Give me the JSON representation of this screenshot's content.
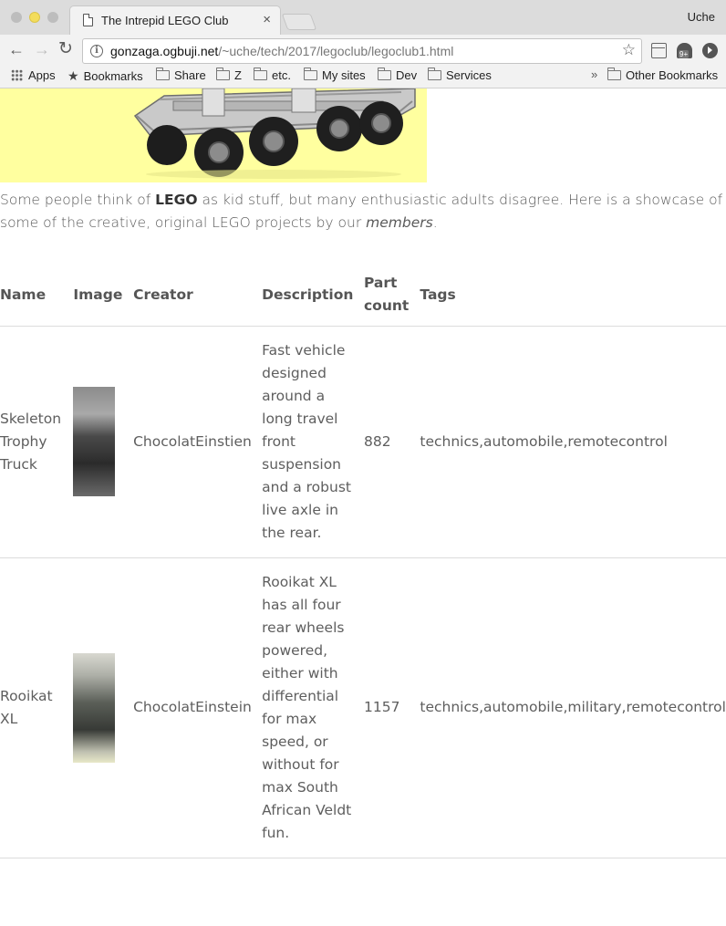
{
  "browser": {
    "tab_title": "The Intrepid LEGO Club",
    "tab_close": "×",
    "profile_name": "Uche",
    "url_host": "gonzaga.ogbuji.net",
    "url_path": "/~uche/tech/2017/legoclub/legoclub1.html",
    "back_icon": "←",
    "forward_icon": "→",
    "reload_icon": "↻",
    "star_icon": "☆",
    "extension_badge": "9+",
    "bookmarks": {
      "apps": "Apps",
      "bookmarks": "Bookmarks",
      "items": [
        "Share",
        "Z",
        "etc.",
        "My sites",
        "Dev",
        "Services"
      ],
      "overflow": "»",
      "other": "Other Bookmarks"
    }
  },
  "page": {
    "intro_before": "Some people think of ",
    "intro_bold": "LEGO",
    "intro_middle": " as kid stuff, but many enthusiastic adults disagree. Here is a showcase of some of the creative, original LEGO projects by our ",
    "intro_em": "members",
    "intro_after": ".",
    "table": {
      "headers": {
        "name": "Name",
        "image": "Image",
        "creator": "Creator",
        "description": "Description",
        "part_count": "Part count",
        "tags": "Tags"
      },
      "rows": [
        {
          "name": "Skeleton Trophy Truck",
          "creator": "ChocolatEinstien",
          "description": "Fast vehicle designed around a long travel front suspension and a robust live axle in the rear.",
          "part_count": "882",
          "tags": "technics,automobile,remotecontrol"
        },
        {
          "name": "Rooikat XL",
          "creator": "ChocolatEinstein",
          "description": "Rooikat XL has all four rear wheels powered, either with differential for max speed, or without for max South African Veldt fun.",
          "part_count": "1157",
          "tags": "technics,automobile,military,remotecontrol"
        }
      ]
    }
  },
  "colors": {
    "hero_background": "#ffff9f",
    "text": "#5a5a5a",
    "header_text": "#555555"
  }
}
